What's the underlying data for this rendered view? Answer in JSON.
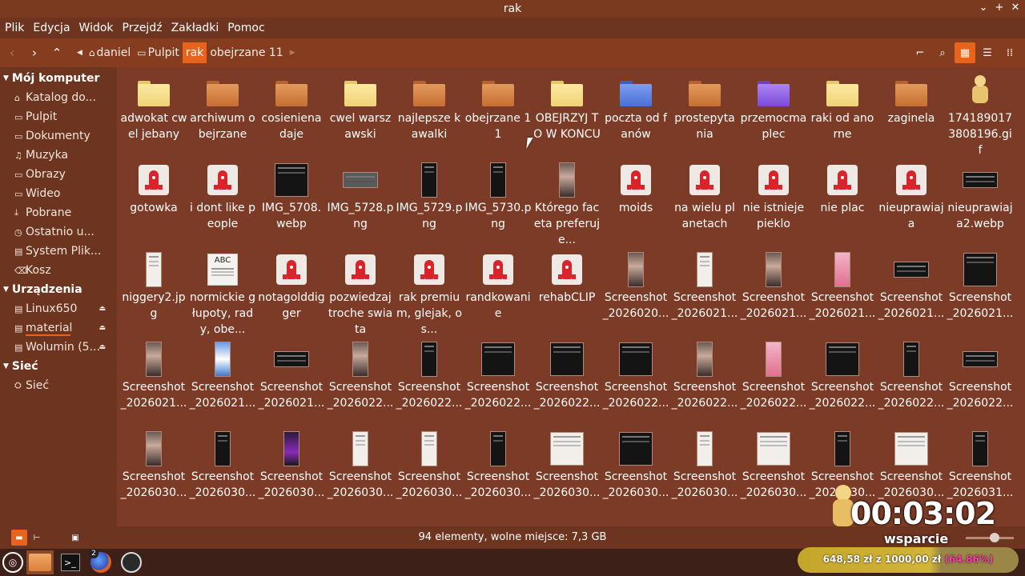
{
  "window": {
    "title": "rak",
    "controls": [
      "⌄",
      "+",
      "✕"
    ]
  },
  "menu": [
    "Plik",
    "Edycja",
    "Widok",
    "Przejdź",
    "Zakładki",
    "Pomoc"
  ],
  "breadcrumb": [
    {
      "label": "daniel",
      "icon": "home-icon"
    },
    {
      "label": "Pulpit",
      "icon": "folder-icon"
    },
    {
      "label": "rak",
      "active": true
    },
    {
      "label": "obejrzane 11"
    }
  ],
  "sidebar": {
    "sections": [
      {
        "title": "Mój komputer",
        "items": [
          {
            "label": "Katalog do...",
            "icon": "home-icon"
          },
          {
            "label": "Pulpit",
            "icon": "desktop-icon"
          },
          {
            "label": "Dokumenty",
            "icon": "documents-icon"
          },
          {
            "label": "Muzyka",
            "icon": "music-icon"
          },
          {
            "label": "Obrazy",
            "icon": "pictures-icon"
          },
          {
            "label": "Wideo",
            "icon": "video-icon"
          },
          {
            "label": "Pobrane",
            "icon": "download-icon"
          },
          {
            "label": "Ostatnio u...",
            "icon": "recent-icon"
          },
          {
            "label": "System Plik...",
            "icon": "drive-icon"
          },
          {
            "label": "Kosz",
            "icon": "trash-icon"
          }
        ]
      },
      {
        "title": "Urządzenia",
        "items": [
          {
            "label": "Linux650",
            "icon": "drive-icon",
            "eject": true
          },
          {
            "label": "material",
            "icon": "drive-icon",
            "eject": true,
            "usage": 0.6
          },
          {
            "label": "Wolumin (5...",
            "icon": "drive-icon",
            "eject": true
          }
        ]
      },
      {
        "title": "Sieć",
        "items": [
          {
            "label": "Sieć",
            "icon": "network-icon"
          }
        ]
      }
    ]
  },
  "files": [
    {
      "name": "adwokat cwel jebany",
      "kind": "folder-yellow"
    },
    {
      "name": "archiwum obejrzane",
      "kind": "folder-orange"
    },
    {
      "name": "cosieniena daje",
      "kind": "folder-orange"
    },
    {
      "name": "cwel warszawski",
      "kind": "folder-yellow"
    },
    {
      "name": "najlepsze kawalki",
      "kind": "folder-orange"
    },
    {
      "name": "obejrzane 11",
      "kind": "folder-orange"
    },
    {
      "name": "OBEJRZYJ TO W KONCU",
      "kind": "folder-yellow"
    },
    {
      "name": "poczta od fanów",
      "kind": "folder-blue"
    },
    {
      "name": "prostepytania",
      "kind": "folder-orange"
    },
    {
      "name": "przemocmaplec",
      "kind": "folder-purple"
    },
    {
      "name": "raki od anorne",
      "kind": "folder-yellow"
    },
    {
      "name": "zaginela",
      "kind": "folder-orange"
    },
    {
      "name": "1741890173808196.gif",
      "kind": "gif"
    },
    {
      "name": "gotowka",
      "kind": "rocket"
    },
    {
      "name": "i dont like people",
      "kind": "rocket"
    },
    {
      "name": "IMG_5708.webp",
      "kind": "shot-dark-sq"
    },
    {
      "name": "IMG_5728.png",
      "kind": "shot-gray-wide"
    },
    {
      "name": "IMG_5729.png",
      "kind": "shot-dark-tall"
    },
    {
      "name": "IMG_5730.png",
      "kind": "shot-dark-tall"
    },
    {
      "name": "Którego faceta preferuje...",
      "kind": "shot-photo-tall"
    },
    {
      "name": "moids",
      "kind": "rocket"
    },
    {
      "name": "na wielu planetach",
      "kind": "rocket"
    },
    {
      "name": "nie istnieje pieklo",
      "kind": "rocket"
    },
    {
      "name": "nie plac",
      "kind": "rocket"
    },
    {
      "name": "nieuprawiaja",
      "kind": "rocket"
    },
    {
      "name": "nieuprawiaja2.webp",
      "kind": "shot-dark-wide"
    },
    {
      "name": "niggery2.jpg",
      "kind": "shot-light-tall"
    },
    {
      "name": "normickie głupoty, rady, obe...",
      "kind": "abc"
    },
    {
      "name": "notagolddigger",
      "kind": "rocket"
    },
    {
      "name": "pozwiedzaj troche swiata",
      "kind": "rocket"
    },
    {
      "name": "rak premium, glejak, os...",
      "kind": "rocket"
    },
    {
      "name": "randkowanie",
      "kind": "rocket"
    },
    {
      "name": "rehabCLIP",
      "kind": "rocket"
    },
    {
      "name": "Screenshot_2026020...",
      "kind": "shot-photo-tall"
    },
    {
      "name": "Screenshot_2026021...",
      "kind": "shot-light-tall"
    },
    {
      "name": "Screenshot_2026021...",
      "kind": "shot-photo-tall"
    },
    {
      "name": "Screenshot_2026021...",
      "kind": "shot-pink-tall"
    },
    {
      "name": "Screenshot_2026021...",
      "kind": "shot-dark-wide"
    },
    {
      "name": "Screenshot_2026021...",
      "kind": "shot-dark-sq"
    },
    {
      "name": "Screenshot_2026021...",
      "kind": "shot-photo-tall"
    },
    {
      "name": "Screenshot_2026021...",
      "kind": "shot-blue-tall"
    },
    {
      "name": "Screenshot_2026021...",
      "kind": "shot-dark-wide"
    },
    {
      "name": "Screenshot_2026022...",
      "kind": "shot-photo-tall"
    },
    {
      "name": "Screenshot_2026022...",
      "kind": "shot-dark-tall"
    },
    {
      "name": "Screenshot_2026022...",
      "kind": "shot-dark-sq"
    },
    {
      "name": "Screenshot_2026022...",
      "kind": "shot-dark-sq"
    },
    {
      "name": "Screenshot_2026022...",
      "kind": "shot-dark-sq"
    },
    {
      "name": "Screenshot_2026022...",
      "kind": "shot-photo-tall"
    },
    {
      "name": "Screenshot_2026022...",
      "kind": "shot-pink-tall"
    },
    {
      "name": "Screenshot_2026022...",
      "kind": "shot-dark-sq"
    },
    {
      "name": "Screenshot_2026022...",
      "kind": "shot-dark-tall"
    },
    {
      "name": "Screenshot_2026022...",
      "kind": "shot-dark-wide"
    },
    {
      "name": "Screenshot_2026030...",
      "kind": "shot-photo-tall"
    },
    {
      "name": "Screenshot_2026030...",
      "kind": "shot-dark-tall"
    },
    {
      "name": "Screenshot_2026030...",
      "kind": "shot-purple-tall"
    },
    {
      "name": "Screenshot_2026030...",
      "kind": "shot-light-tall"
    },
    {
      "name": "Screenshot_2026030...",
      "kind": "shot-light-tall"
    },
    {
      "name": "Screenshot_2026030...",
      "kind": "shot-dark-tall"
    },
    {
      "name": "Screenshot_2026030...",
      "kind": "shot-light-sq"
    },
    {
      "name": "Screenshot_2026030...",
      "kind": "shot-dark-sq"
    },
    {
      "name": "Screenshot_2026030...",
      "kind": "shot-light-tall"
    },
    {
      "name": "Screenshot_2026030...",
      "kind": "shot-light-sq"
    },
    {
      "name": "Screenshot_2026030...",
      "kind": "shot-dark-tall"
    },
    {
      "name": "Screenshot_2026030...",
      "kind": "shot-light-sq"
    },
    {
      "name": "Screenshot_2026031...",
      "kind": "shot-dark-tall"
    }
  ],
  "status": {
    "text": "94 elementy, wolne miejsce: 7,3 GB"
  },
  "taskbar": {
    "firefox_badge": "2"
  },
  "overlay": {
    "timer": "00:03:02",
    "support_label": "wsparcie",
    "donation_text": "648,58 zł z 1000,00 zł",
    "donation_percent": "(64.86%)",
    "donation_fraction": 0.6486
  }
}
